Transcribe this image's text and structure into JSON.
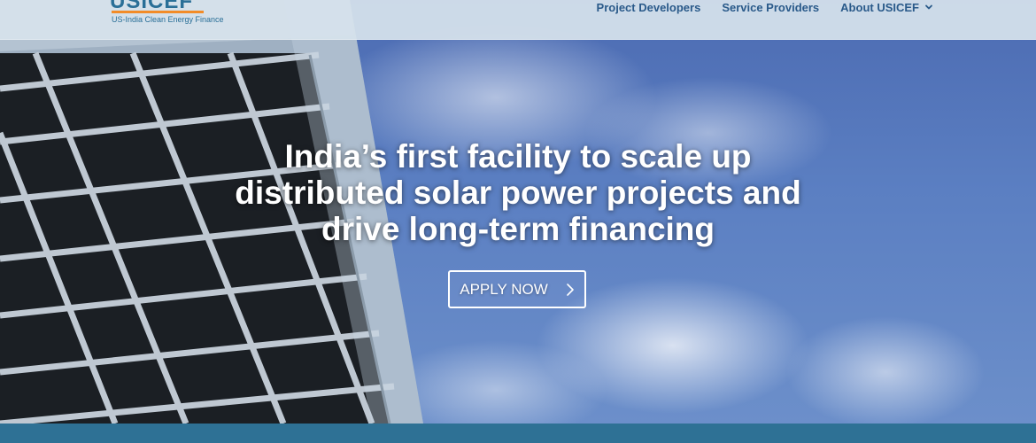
{
  "header": {
    "logo": {
      "name": "USICEF",
      "tagline": "US-India Clean Energy Finance"
    },
    "nav": [
      {
        "label": "Project Developers"
      },
      {
        "label": "Service Providers"
      },
      {
        "label": "About USICEF",
        "has_dropdown": true
      }
    ]
  },
  "hero": {
    "title_line1": "India’s first facility to scale up",
    "title_line2": "distributed solar power projects and",
    "title_line3": "drive long-term financing",
    "cta_label": "APPLY NOW",
    "cta_icon": "chevron-right-icon"
  },
  "colors": {
    "brand": "#2a6f97",
    "accent": "#f28c28",
    "strip": "#2e7195",
    "header_bg": "#d6e2ec"
  }
}
